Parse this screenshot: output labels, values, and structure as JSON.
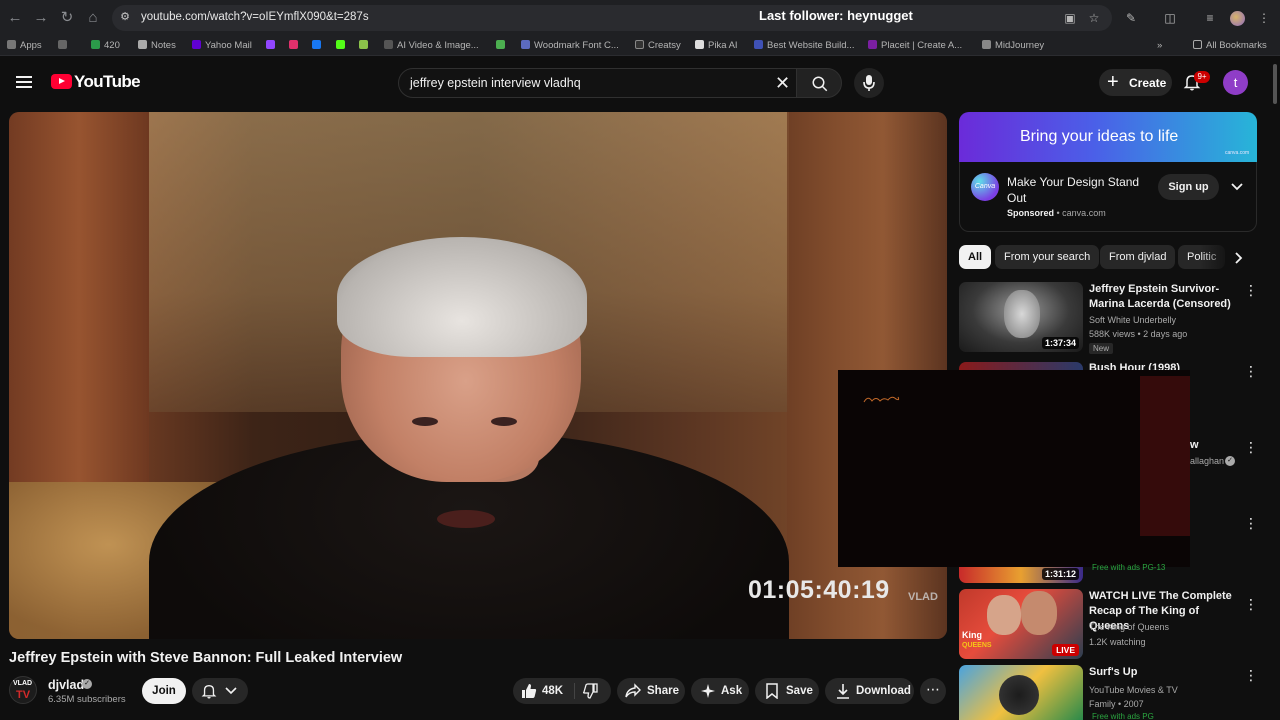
{
  "browser": {
    "url": "youtube.com/watch?v=oIEYmflX090&t=287s",
    "overlay_text": "Last follower: heynugget",
    "bookmarks": [
      "Apps",
      "420",
      "Notes",
      "Yahoo Mail",
      "AI Video & Image...",
      "Woodmark Font C...",
      "Creatsy",
      "Pika AI",
      "Best Website Build...",
      "Placeit | Create A...",
      "MidJourney"
    ],
    "all_bookmarks": "All Bookmarks"
  },
  "header": {
    "logo_text": "YouTube",
    "search_value": "jeffrey epstein interview vladhq",
    "create_label": "Create",
    "notification_count": "9+",
    "avatar_letter": "t"
  },
  "player": {
    "timecode": "01:05:40:19",
    "watermark": "VLAD"
  },
  "video": {
    "title": "Jeffrey Epstein with Steve Bannon: Full Leaked Interview",
    "channel_name": "djvlad",
    "subscribers": "6.35M subscribers",
    "channel_avatar_top": "VLAD",
    "channel_avatar_bottom": "TV",
    "join_label": "Join",
    "likes": "48K",
    "share_label": "Share",
    "ask_label": "Ask",
    "save_label": "Save",
    "download_label": "Download"
  },
  "ad": {
    "banner_text": "Bring your ideas to life",
    "banner_small": "canva.com",
    "logo_text": "Canva",
    "title": "Make Your Design Stand Out",
    "sponsored": "Sponsored",
    "domain": "canva.com",
    "signup_label": "Sign up"
  },
  "chips": [
    "All",
    "From your search",
    "From djvlad",
    "Politic"
  ],
  "recommendations": [
    {
      "title": "Jeffrey Epstein Survivor-Marina Lacerda (Censored)",
      "channel": "Soft White Underbelly",
      "meta": "588K views • 2 days ago",
      "duration": "1:37:34",
      "badge": "New"
    },
    {
      "title": "Bush Hour (1998)",
      "channel": "",
      "meta": "",
      "duration": ""
    },
    {
      "title": "...w",
      "channel": "...allaghan",
      "meta": "",
      "duration": ""
    },
    {
      "title": "",
      "channel": "",
      "meta": "Free with ads   PG-13",
      "duration": "1:31:12"
    },
    {
      "title": "WATCH LIVE The Complete Recap of The King of Queens",
      "channel": "The King of Queens",
      "meta": "1.2K watching",
      "duration": "LIVE"
    },
    {
      "title": "Surf's Up",
      "channel": "YouTube Movies & TV",
      "meta": "Family • 2007",
      "duration": "",
      "badge": "Free with ads   PG"
    }
  ],
  "colors": {
    "background": "#0f0f0f",
    "accent_red": "#ff0033",
    "avatar_purple": "#8f3dc7"
  }
}
